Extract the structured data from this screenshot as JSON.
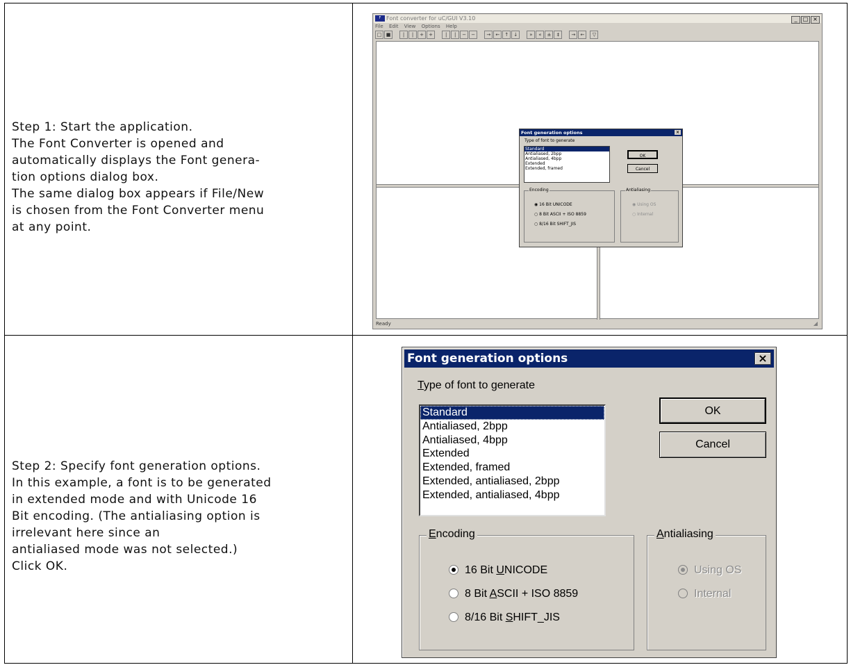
{
  "steps": [
    {
      "lines": [
        "Step 1: Start the application.",
        "The Font Converter is opened and",
        "automatically displays the Font genera-",
        "tion options dialog box.",
        "The same dialog box appears if File/New",
        "is chosen from the Font Converter menu",
        "at any point."
      ]
    },
    {
      "lines": [
        "Step 2: Specify font generation options.",
        "In this example, a font is to be generated",
        "in extended mode and with Unicode 16",
        "Bit encoding. (The antialiasing option is",
        "irrelevant here since an",
        "antialiased mode was not selected.)",
        "Click OK."
      ]
    }
  ],
  "app_window": {
    "title": "Font converter for uC/GUI V3.10",
    "icon_text": "F",
    "menu": [
      "File",
      "Edit",
      "View",
      "Options",
      "Help"
    ],
    "status": "Ready",
    "window_buttons": [
      "_",
      "□",
      "×"
    ]
  },
  "dialog": {
    "title": "Font generation options",
    "close_glyph": "×",
    "type_label_accel": "T",
    "type_label_rest": "ype of font to generate",
    "font_types": [
      "Standard",
      "Antialiased, 2bpp",
      "Antialiased, 4bpp",
      "Extended",
      "Extended, framed",
      "Extended, antialiased, 2bpp",
      "Extended, antialiased, 4bpp"
    ],
    "selected_font_type": "Standard",
    "ok_label": "OK",
    "cancel_label": "Cancel",
    "encoding_group": {
      "accel": "E",
      "rest": "ncoding",
      "options": [
        {
          "pre": "16 Bit ",
          "accel": "U",
          "post": "NICODE",
          "checked": true
        },
        {
          "pre": "8 Bit ",
          "accel": "A",
          "post": "SCII + ISO 8859",
          "checked": false
        },
        {
          "pre": "8/16 Bit ",
          "accel": "S",
          "post": "HIFT_JIS",
          "checked": false
        }
      ]
    },
    "antialiasing_group": {
      "accel": "A",
      "rest": "ntialiasing",
      "enabled": false,
      "options": [
        {
          "label": "Using OS",
          "checked": true
        },
        {
          "label": "Internal",
          "checked": false
        }
      ]
    }
  },
  "mini_dialog": {
    "title": "Font generation options",
    "type_label": "Type of font to generate",
    "font_types": [
      "Standard",
      "Antialiased, 2bpp",
      "Antialiased, 4bpp",
      "Extended",
      "Extended, framed"
    ],
    "ok_label": "OK",
    "cancel_label": "Cancel",
    "encoding_label": "Encoding",
    "encoding_options": [
      "16 Bit UNICODE",
      "8 Bit ASCII + ISO 8859",
      "8/16 Bit SHIFT_JIS"
    ],
    "antialiasing_label": "Antialiasing",
    "antialiasing_options": [
      "Using OS",
      "Internal"
    ]
  }
}
